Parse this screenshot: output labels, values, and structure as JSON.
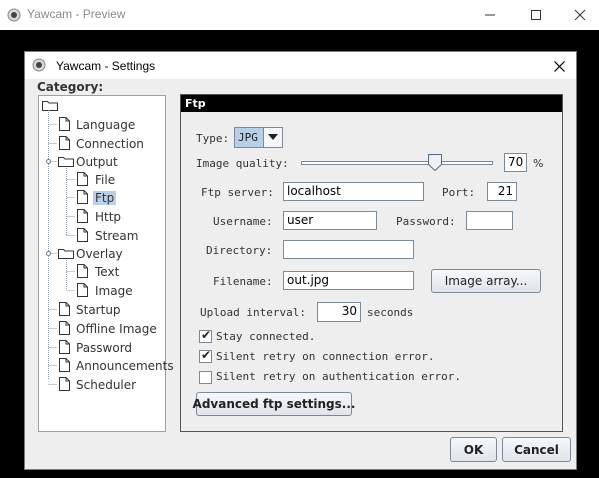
{
  "outer_window": {
    "title": "Yawcam - Preview"
  },
  "dialog": {
    "title": "Yawcam - Settings",
    "category_label": "Category:",
    "tree": [
      {
        "label": "Language",
        "kind": "doc"
      },
      {
        "label": "Connection",
        "kind": "doc"
      },
      {
        "label": "Output",
        "kind": "folder",
        "expanded": true
      },
      {
        "label": "File",
        "kind": "doc"
      },
      {
        "label": "Ftp",
        "kind": "doc",
        "selected": true
      },
      {
        "label": "Http",
        "kind": "doc"
      },
      {
        "label": "Stream",
        "kind": "doc"
      },
      {
        "label": "Overlay",
        "kind": "folder",
        "expanded": true
      },
      {
        "label": "Text",
        "kind": "doc"
      },
      {
        "label": "Image",
        "kind": "doc"
      },
      {
        "label": "Startup",
        "kind": "doc"
      },
      {
        "label": "Offline Image",
        "kind": "doc"
      },
      {
        "label": "Password",
        "kind": "doc"
      },
      {
        "label": "Announcements",
        "kind": "doc"
      },
      {
        "label": "Scheduler",
        "kind": "doc"
      }
    ],
    "panel": {
      "header": "Ftp",
      "type_label": "Type:",
      "type_value": "JPG",
      "quality_label": "Image quality:",
      "quality_value": "70",
      "quality_fraction": 0.7,
      "quality_unit": "%",
      "ftp_server_label": "Ftp server:",
      "ftp_server_value": "localhost",
      "port_label": "Port:",
      "port_value": "21",
      "username_label": "Username:",
      "username_value": "user",
      "password_label": "Password:",
      "password_value": "",
      "directory_label": "Directory:",
      "directory_value": "",
      "filename_label": "Filename:",
      "filename_value": "out.jpg",
      "image_array_button": "Image array...",
      "upload_interval_label": "Upload interval:",
      "upload_interval_value": "30",
      "upload_interval_unit": "seconds",
      "stay_connected_label": "Stay connected.",
      "stay_connected_checked": true,
      "silent_retry_connection_label": "Silent retry on connection error.",
      "silent_retry_connection_checked": true,
      "silent_retry_auth_label": "Silent retry on authentication error.",
      "silent_retry_auth_checked": false,
      "advanced_button": "Advanced ftp settings..."
    },
    "ok_button": "OK",
    "cancel_button": "Cancel"
  },
  "colors": {
    "selection": "#b8cfe5",
    "panel_header": "#000000",
    "background": "#000000",
    "dialog_bg": "#eeeeee"
  }
}
